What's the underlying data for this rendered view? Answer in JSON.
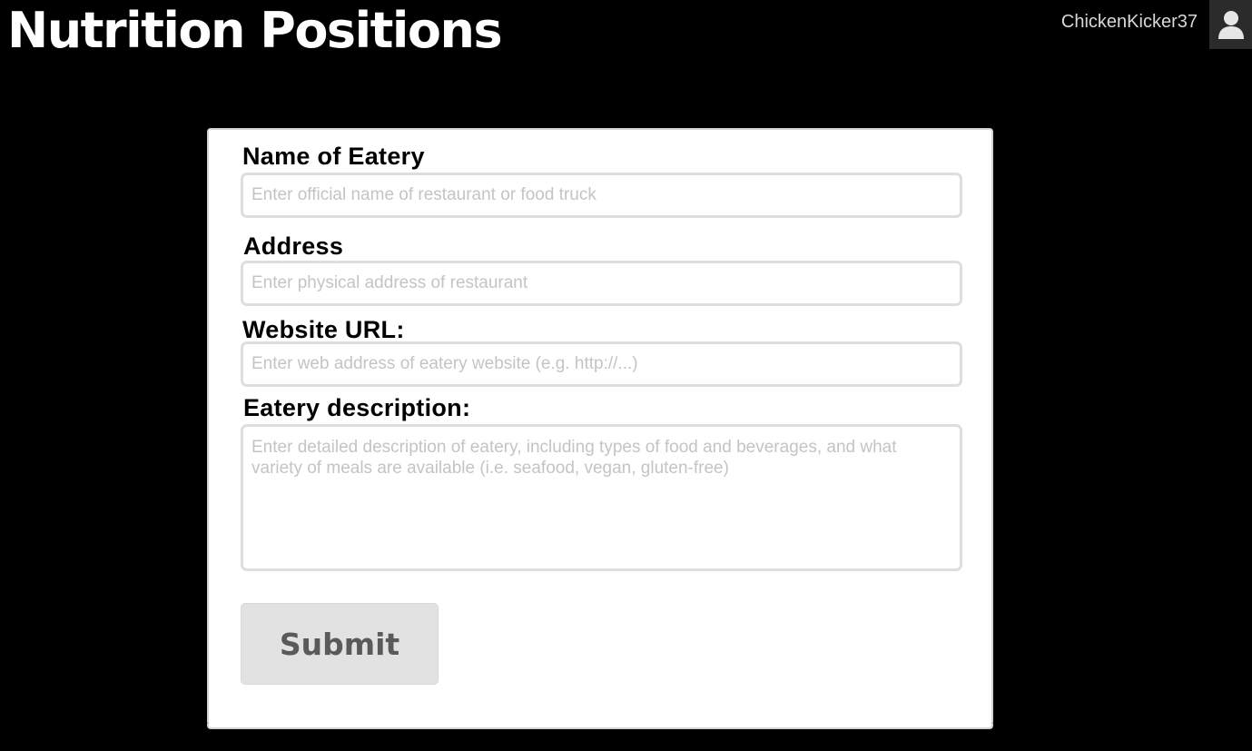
{
  "header": {
    "title": "Nutrition Positions",
    "username": "ChickenKicker37",
    "avatar_icon": "user-icon"
  },
  "form": {
    "name": {
      "label": "Name of Eatery",
      "placeholder": "Enter official name of restaurant or food truck",
      "value": ""
    },
    "address": {
      "label": "Address",
      "placeholder": "Enter physical address of restaurant",
      "value": ""
    },
    "website": {
      "label": "Website URL:",
      "placeholder": "Enter web address of eatery website (e.g. http://...)",
      "value": ""
    },
    "description": {
      "label": "Eatery description:",
      "placeholder": "Enter detailed description of eatery, including types of food and beverages, and what variety of meals are available (i.e. seafood, vegan, gluten-free)",
      "value": ""
    },
    "submit_label": "Submit"
  },
  "colors": {
    "page_background": "#000000",
    "header_text": "#ffffff",
    "card_background": "#ffffff",
    "input_border": "#dedede",
    "placeholder_text": "#c4c4c4",
    "button_background": "#e2e2e3",
    "button_text": "#5a5a5a"
  }
}
